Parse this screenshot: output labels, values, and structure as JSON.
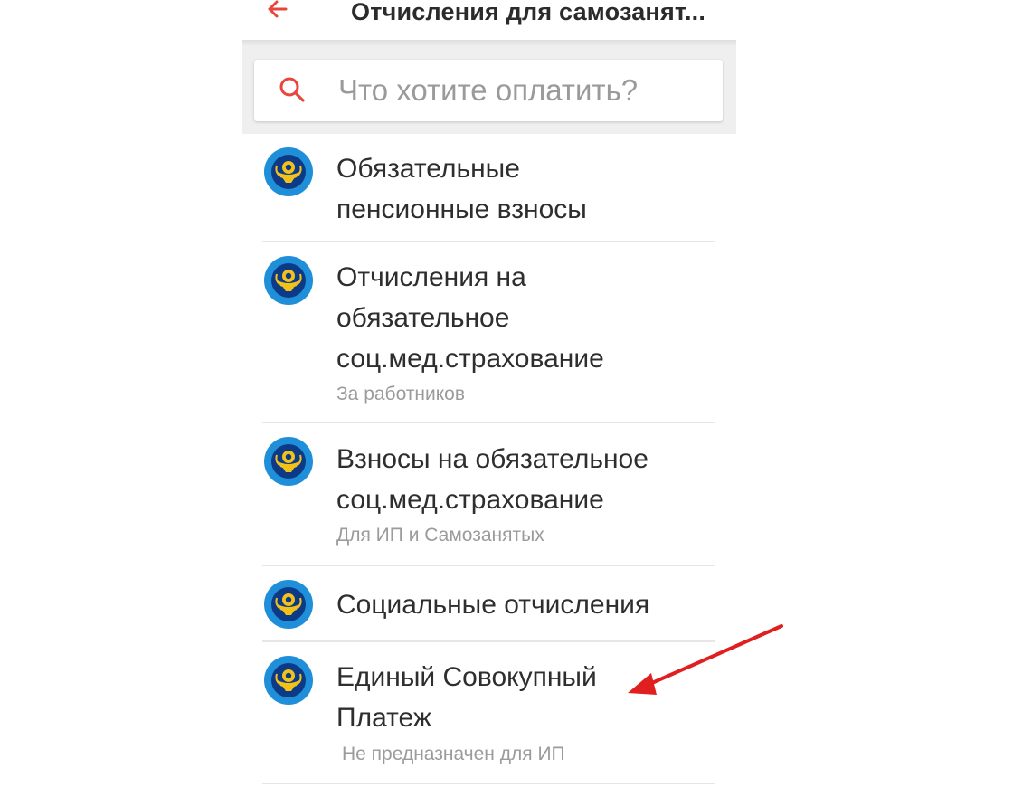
{
  "header": {
    "title": "Отчисления для самозанят...",
    "back_icon": "arrow-left-icon",
    "accent_color": "#e8453c"
  },
  "search": {
    "placeholder": "Что хотите оплатить?",
    "value": "",
    "icon": "search-icon"
  },
  "items": [
    {
      "title_line1": "Обязательные",
      "title_line2": "пенсионные взносы",
      "icon": "state-emblem-icon"
    },
    {
      "title_line1": "Отчисления на",
      "title_line2": "обязательное",
      "title_line3": "соц.мед.страхование",
      "subtitle": "За работников",
      "icon": "state-emblem-icon"
    },
    {
      "title_line1": "Взносы на обязательное",
      "title_line2": "соц.мед.страхование",
      "subtitle": "Для ИП и Самозанятых",
      "icon": "state-emblem-icon"
    },
    {
      "title_line1": "Социальные отчисления",
      "icon": "state-emblem-icon"
    },
    {
      "title_line1": "Единый Совокупный",
      "title_line2": "Платеж",
      "subtitle": "Не предназначен для ИП",
      "icon": "state-emblem-icon"
    }
  ],
  "annotation": {
    "arrow_color": "#e02020",
    "icon": "annotation-arrow-icon"
  }
}
